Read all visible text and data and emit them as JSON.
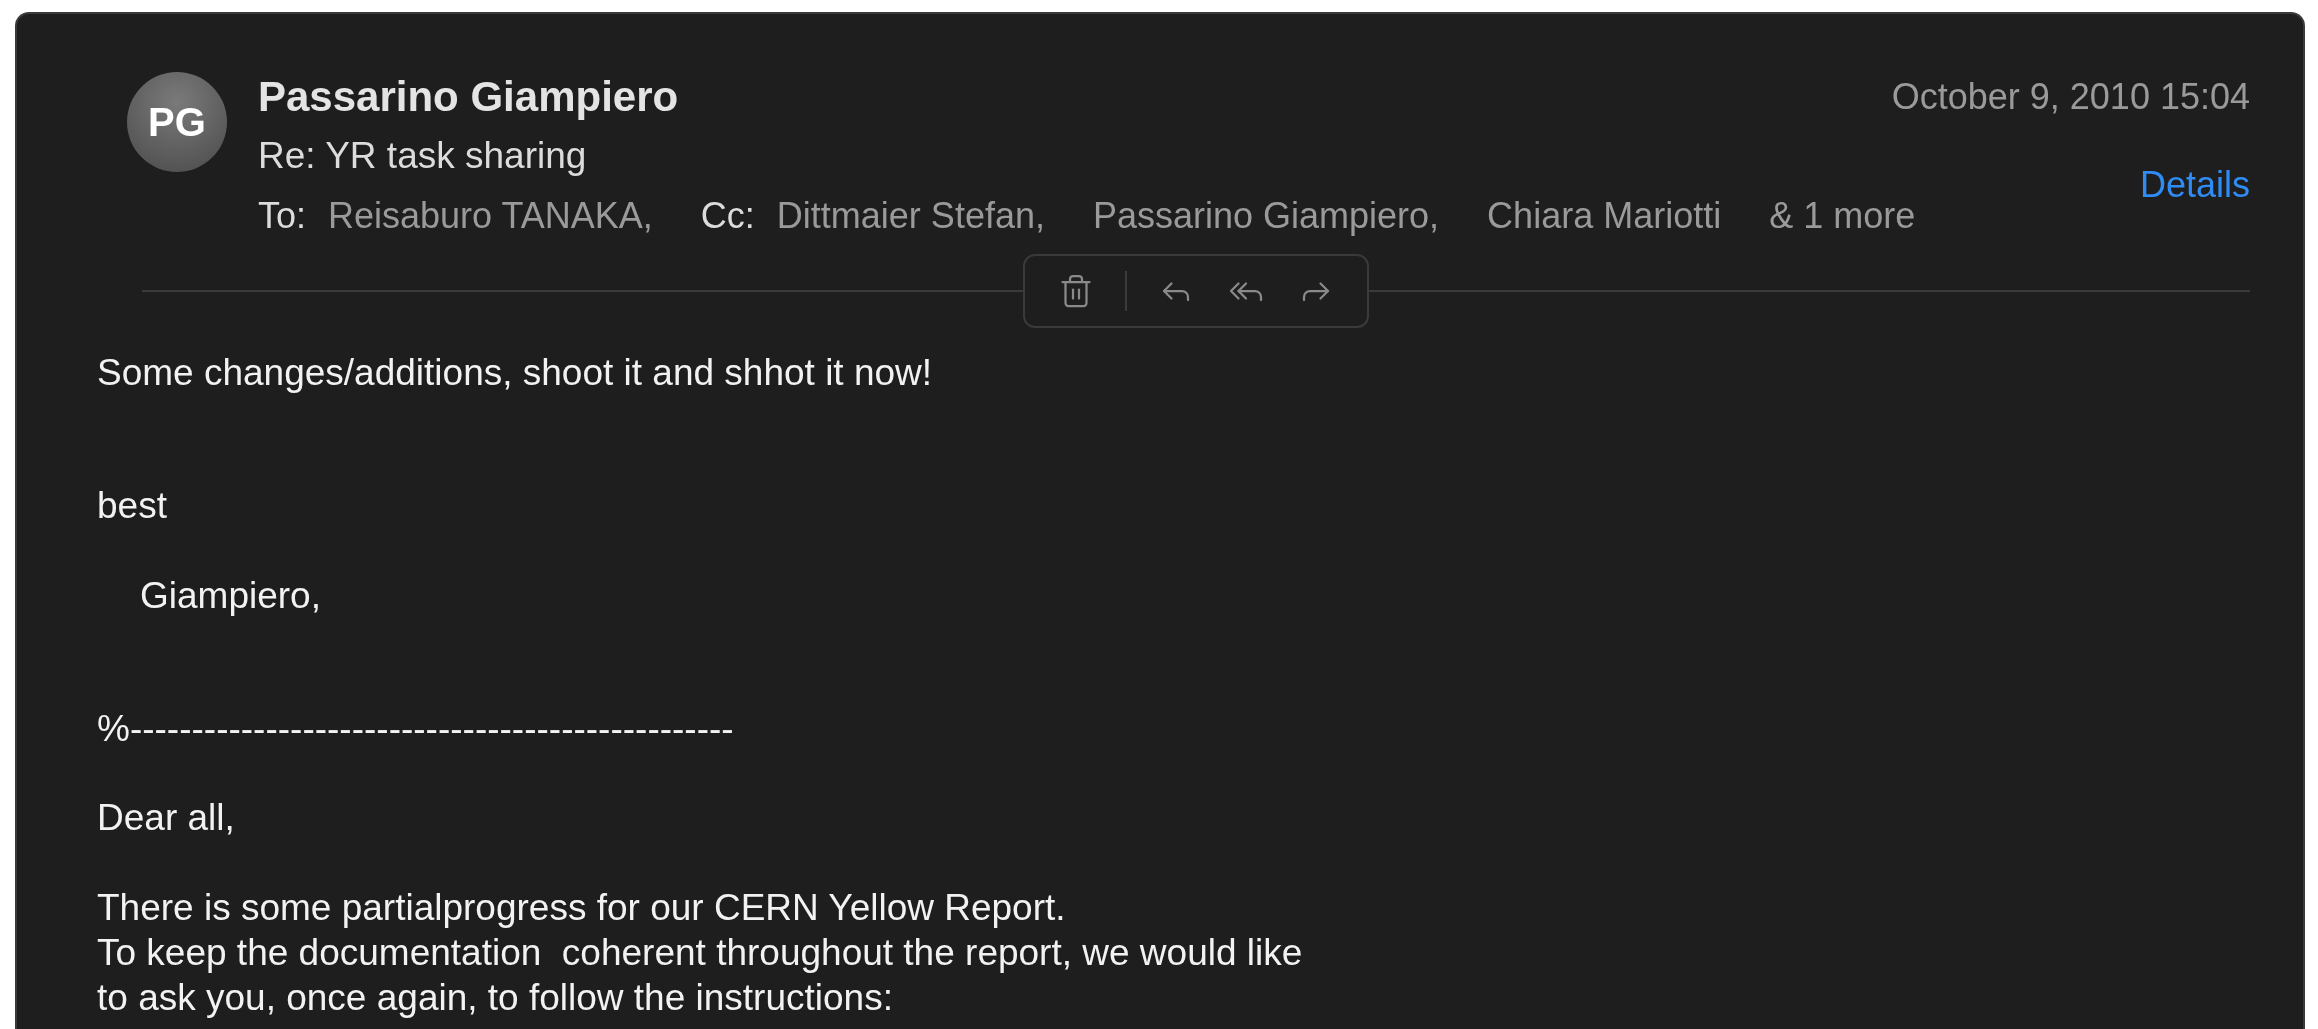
{
  "message": {
    "avatar_initials": "PG",
    "sender": "Passarino Giampiero",
    "subject": "Re: YR task sharing",
    "date": "October 9, 2010 15:04",
    "to_label": "To:",
    "to": [
      "Reisaburo TANAKA,"
    ],
    "cc_label": "Cc:",
    "cc": [
      "Dittmaier Stefan,",
      "Passarino Giampiero,",
      "Chiara Mariotti"
    ],
    "more": "& 1 more",
    "details_link": "Details"
  },
  "toolbar": [
    {
      "kind": "trash"
    },
    {
      "kind": "reply"
    },
    {
      "kind": "reply_all"
    },
    {
      "kind": "forward"
    }
  ],
  "body": [
    {
      "lines": [
        "Some changes/additions, shoot it and shhot it now!"
      ],
      "indent": false
    },
    {
      "lines": [
        "best"
      ],
      "indent": false
    },
    {
      "lines": [
        "Giampiero,"
      ],
      "indent": true
    },
    {
      "lines": [
        "%-------------------------------------------------"
      ],
      "indent": false
    },
    {
      "lines": [
        "Dear all,"
      ],
      "indent": false
    },
    {
      "lines": [
        "There is some partialprogress for our CERN Yellow Report.",
        "To keep the documentation  coherent throughout the report, we would like",
        "to ask you, once again, to follow the instructions:"
      ],
      "indent": false
    }
  ]
}
